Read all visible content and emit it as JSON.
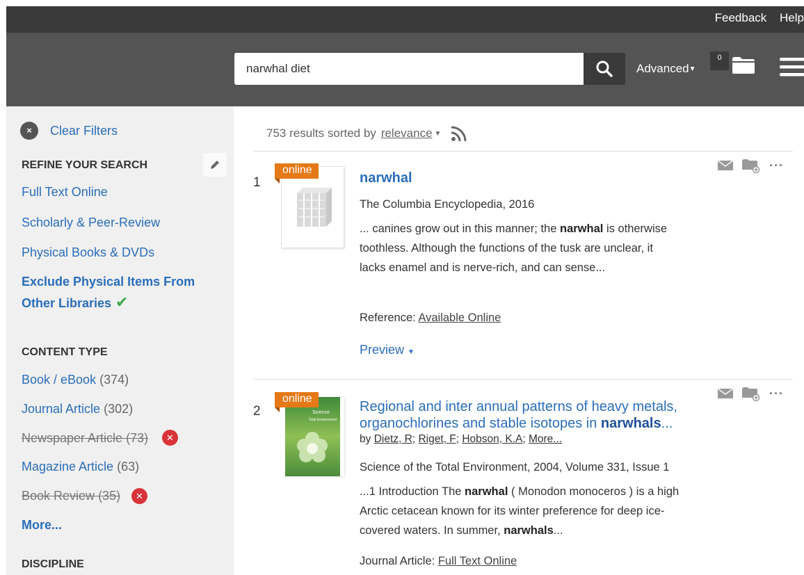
{
  "topbar": {
    "feedback_label": "Feedback",
    "help_label": "Help"
  },
  "search": {
    "value": "narwhal diet",
    "advanced_label": "Advanced",
    "folder_count": "0"
  },
  "sidebar": {
    "clear_filters": "Clear Filters",
    "refine_heading": "REFINE YOUR SEARCH",
    "refine_items": [
      "Full Text Online",
      "Scholarly & Peer-Review",
      "Physical Books & DVDs"
    ],
    "exclude_line1": "Exclude Physical Items From",
    "exclude_line2": "Other Libraries",
    "content_type_heading": "CONTENT TYPE",
    "content_types": [
      {
        "label": "Book / eBook",
        "count": "(374)"
      },
      {
        "label": "Journal Article",
        "count": "(302)"
      },
      {
        "label": "Newspaper Article",
        "count": "(73)"
      },
      {
        "label": "Magazine Article",
        "count": "(63)"
      },
      {
        "label": "Book Review",
        "count": "(35)"
      }
    ],
    "more_label": "More...",
    "discipline_heading": "DISCIPLINE"
  },
  "results": {
    "count_text": "753 results sorted by",
    "sort_label": "relevance",
    "items": [
      {
        "number": "1",
        "badge": "online",
        "title": "narwhal",
        "source": "The Columbia Encyclopedia, 2016",
        "snippet_1": "... canines grow out in this manner; the ",
        "snippet_bold": "narwhal",
        "snippet_2": " is otherwise toothless. Although the functions of the tusk are unclear, it lacks enamel and is nerve-rich, and can sense...",
        "type_label": "Reference:",
        "access_label": "Available Online",
        "preview_label": "Preview"
      },
      {
        "number": "2",
        "badge": "online",
        "title_1": "Regional and inter annual patterns of heavy metals, organochlorines and stable isotopes in ",
        "title_bold": "narwhals",
        "title_2": "...",
        "by": "by",
        "authors": [
          "Dietz, R",
          "Riget, F",
          "Hobson, K.A"
        ],
        "authors_more": "More...",
        "source": "Science of the Total Environment, 2004, Volume 331, Issue 1",
        "snippet_1": "...1 Introduction The ",
        "snippet_bold_1": "narwhal",
        "snippet_2": " ( Monodon monoceros ) is a high Arctic cetacean known for its winter preference for deep ice-covered waters. In summer, ",
        "snippet_bold_2": "narwhals",
        "snippet_3": "...",
        "type_label": "Journal Article:",
        "access_label": "Full Text Online",
        "cover_title": "Science of the Total Environment"
      }
    ]
  },
  "colors": {
    "link": "#2a6ebb",
    "badge": "#e57917",
    "remove": "#d9343a",
    "check": "#3ea84a",
    "header": "#555455"
  }
}
